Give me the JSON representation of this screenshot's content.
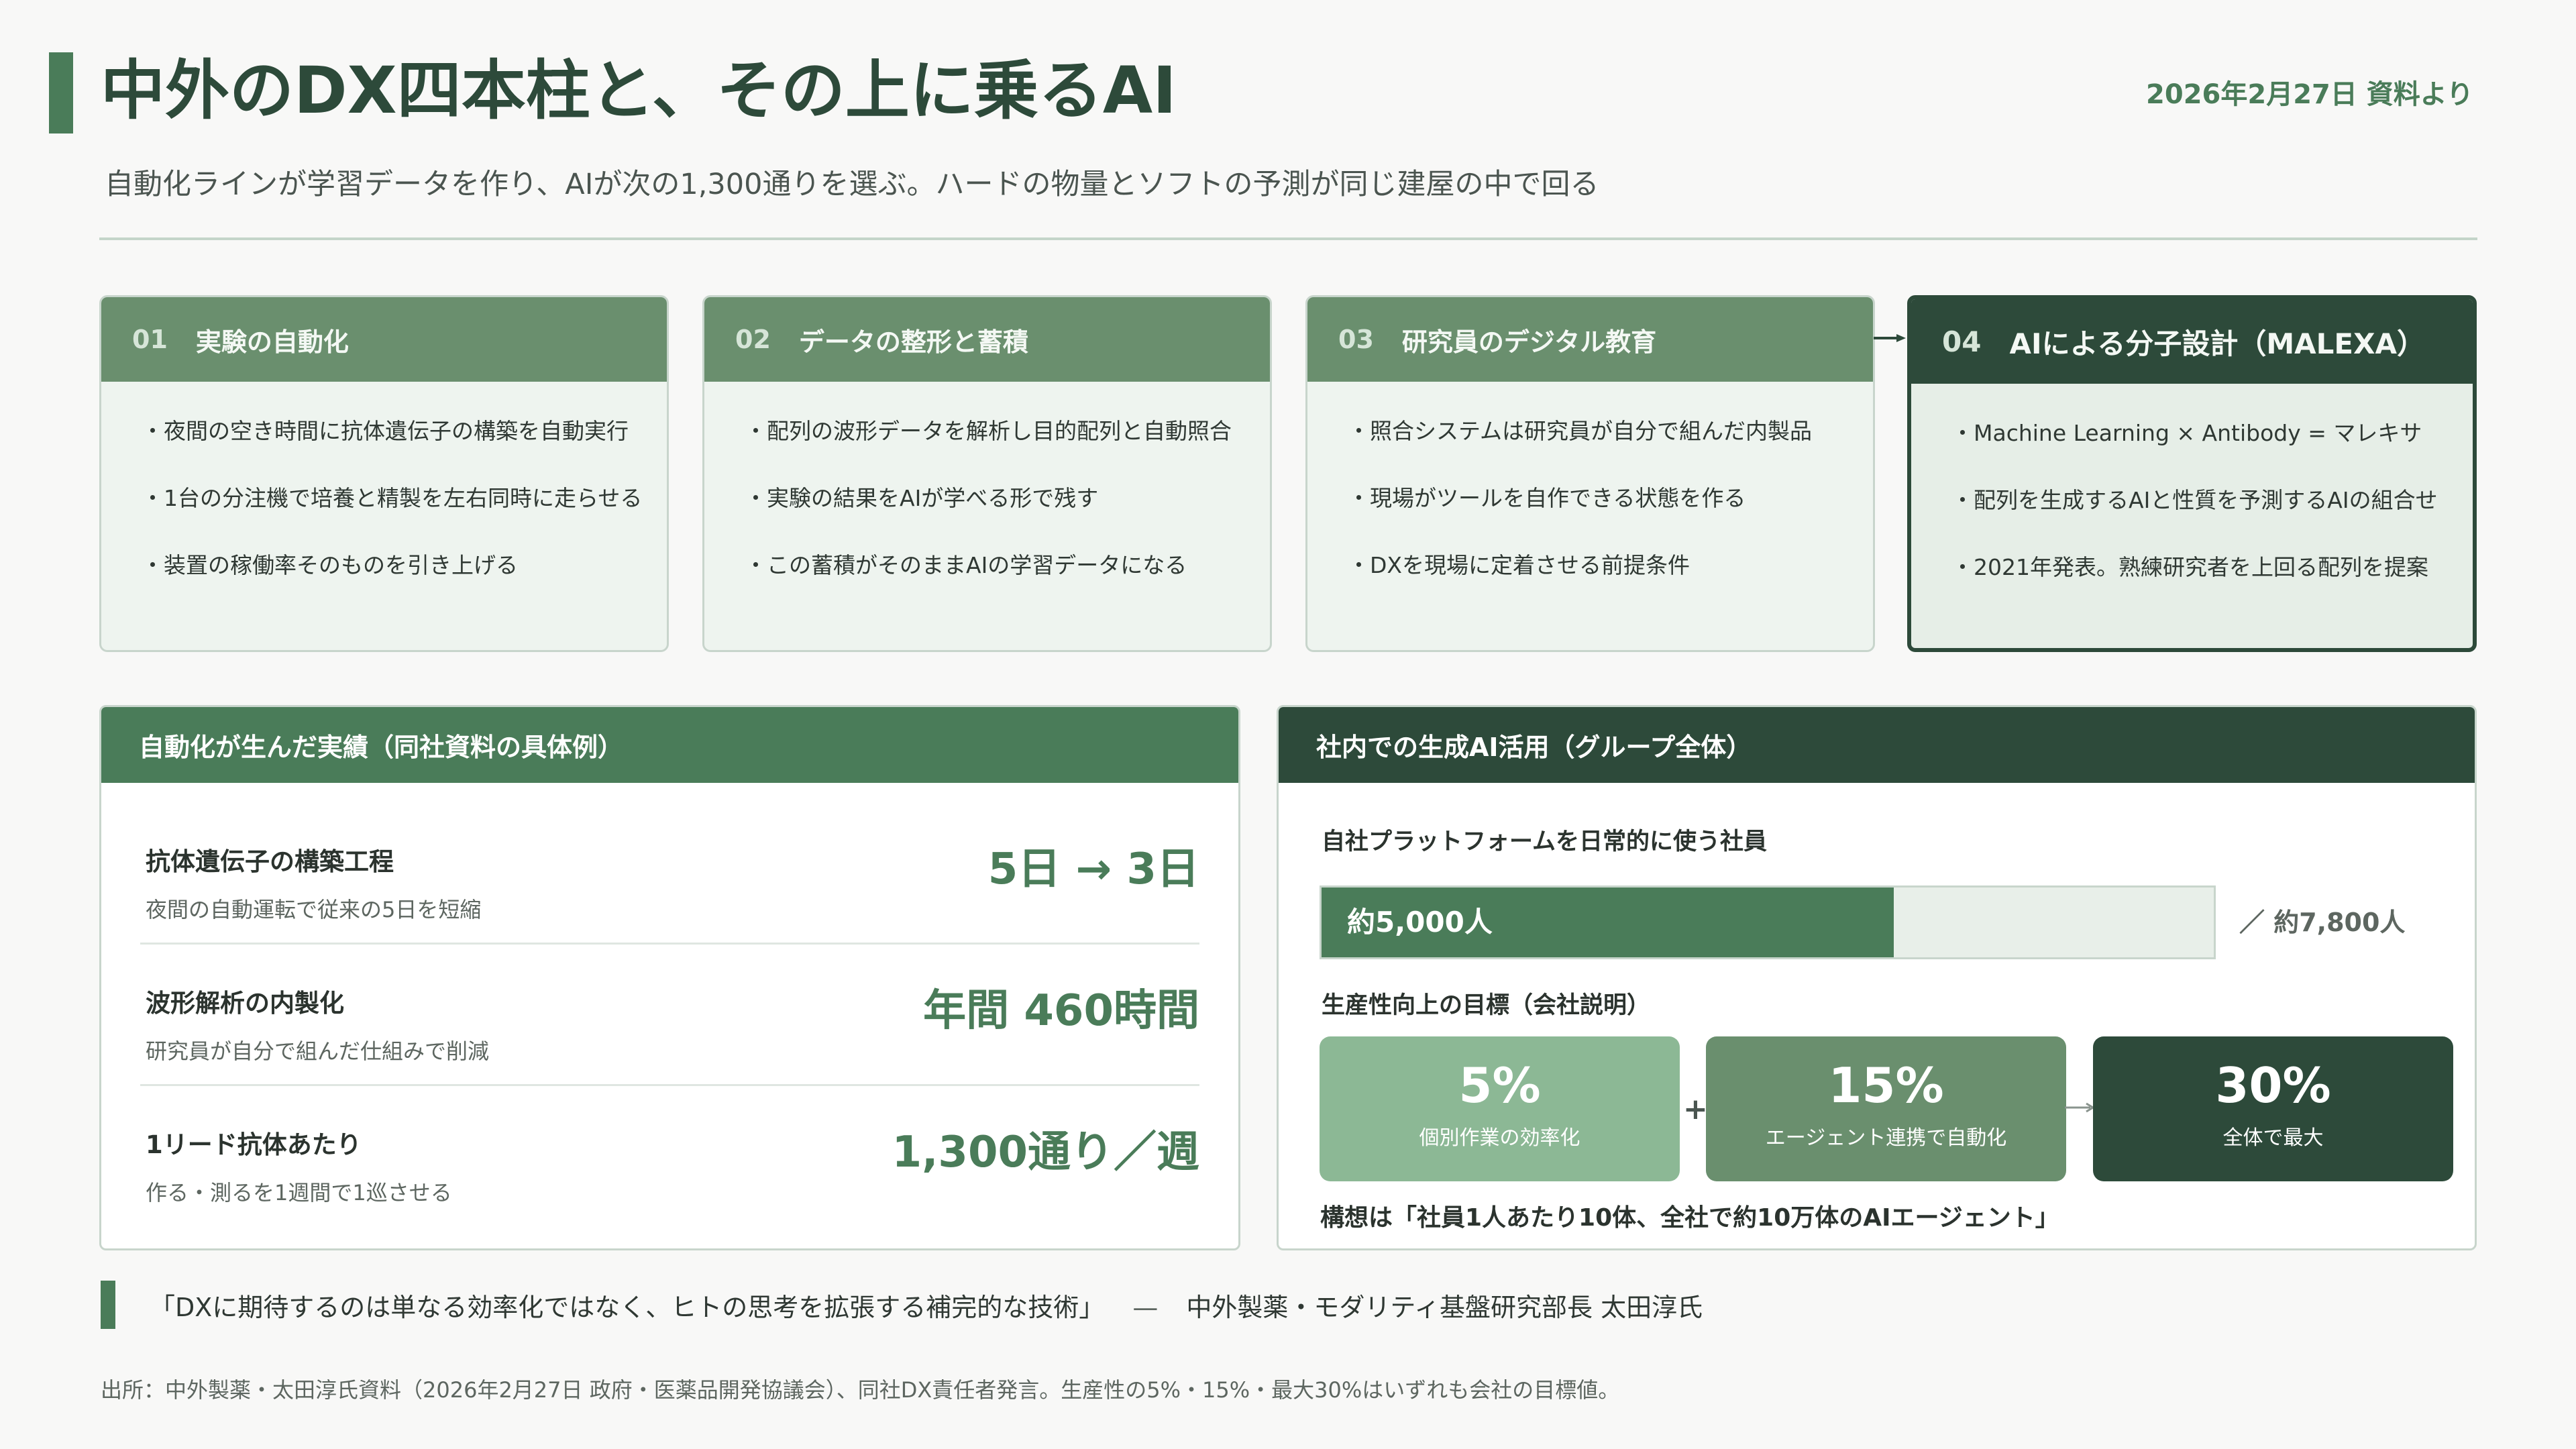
{
  "header": {
    "title": "中外のDX四本柱と、その上に乗るAI",
    "date": "2026年2月27日 資料より",
    "subtitle": "自動化ラインが学習データを作り、AIが次の1,300通りを選ぶ。ハードの物量とソフトの予測が同じ建屋の中で回る"
  },
  "pillars": [
    {
      "num": "01",
      "title": "実験の自動化",
      "items": [
        "・夜間の空き時間に抗体遺伝子の構築を自動実行",
        "・1台の分注機で培養と精製を左右同時に走らせる",
        "・装置の稼働率そのものを引き上げる"
      ]
    },
    {
      "num": "02",
      "title": "データの整形と蓄積",
      "items": [
        "・配列の波形データを解析し目的配列と自動照合",
        "・実験の結果をAIが学べる形で残す",
        "・この蓄積がそのままAIの学習データになる"
      ]
    },
    {
      "num": "03",
      "title": "研究員のデジタル教育",
      "items": [
        "・照合システムは研究員が自分で組んだ内製品",
        "・現場がツールを自作できる状態を作る",
        "・DXを現場に定着させる前提条件"
      ]
    },
    {
      "num": "04",
      "title": "AIによる分子設計（MALEXA）",
      "items": [
        "・Machine Learning × Antibody = マレキサ",
        "・配列を生成するAIと性質を予測するAIの組合せ",
        "・2021年発表。熟練研究者を上回る配列を提案"
      ]
    }
  ],
  "achievements": {
    "title": "自動化が生んだ実績（同社資料の具体例）",
    "rows": [
      {
        "label": "抗体遺伝子の構築工程",
        "desc": "夜間の自動運転で従来の5日を短縮",
        "value": "5日 → 3日"
      },
      {
        "label": "波形解析の内製化",
        "desc": "研究員が自分で組んだ仕組みで削減",
        "value": "年間 460時間"
      },
      {
        "label": "1リード抗体あたり",
        "desc": "作る・測るを1週間で1巡させる",
        "value": "1,300通り／週"
      }
    ]
  },
  "ai_usage": {
    "title": "社内での生成AI活用（グループ全体）",
    "platform_label": "自社プラットフォームを日常的に使う社員",
    "users_text": "約5,000人",
    "total_text": "／ 約7,800人",
    "users": 5000,
    "total": 7800,
    "goal_label": "生産性向上の目標（会社説明）",
    "goals": [
      {
        "value": "5%",
        "desc": "個別作業の効率化",
        "color": "#8cb895"
      },
      {
        "value": "15%",
        "desc": "エージェント連携で自動化",
        "color": "#6a8f6e"
      },
      {
        "value": "30%",
        "desc": "全体で最大",
        "color": "#2d4a3a"
      }
    ],
    "plus": "+",
    "note": "構想は「社員1人あたり10体、全社で約10万体のAIエージェント」"
  },
  "quote": {
    "text": "「DXに期待するのは単なる効率化ではなく、ヒトの思考を拡張する補完的な技術」",
    "dash": "—",
    "attribution": "中外製薬・モダリティ基盤研究部長 太田淳氏"
  },
  "source": "出所：中外製薬・太田淳氏資料（2026年2月27日 政府・医薬品開発協議会）、同社DX責任者発言。生産性の5%・15%・最大30%はいずれも会社の目標値。"
}
